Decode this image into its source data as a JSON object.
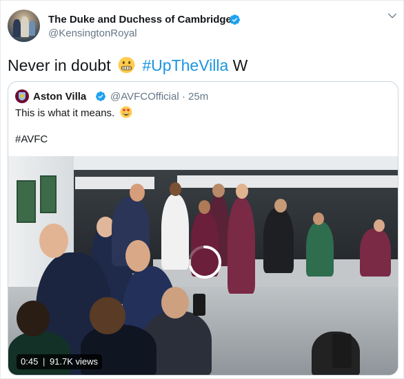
{
  "tweet": {
    "author_name": "The Duke and Duchess of Cambridge",
    "author_handle": "@KensingtonRoyal",
    "text_before": "Never in doubt",
    "hashtag": "#UpTheVilla",
    "text_after": "W",
    "emoji": "grimacing-face-emoji"
  },
  "quoted": {
    "author_name": "Aston Villa",
    "author_handle": "@AVFCOfficial · 25m",
    "text": "This is what it means.",
    "emoji": "heart-eyes-emoji",
    "hashtag": "#AVFC"
  },
  "video": {
    "duration": "0:45",
    "separator": "|",
    "views": "91.7K views"
  },
  "colors": {
    "link": "#1b95e0",
    "verified": "#1da1f2",
    "secondary_text": "#657786",
    "border": "#ccd6dd"
  },
  "icons": [
    "verified-badge-icon",
    "chevron-down-icon",
    "loading-spinner-icon"
  ]
}
